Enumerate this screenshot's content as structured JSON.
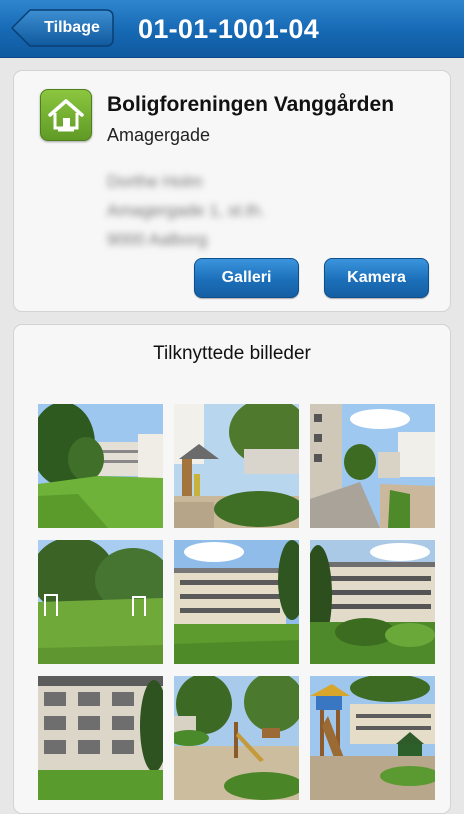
{
  "nav": {
    "back_label": "Tilbage",
    "title": "01-01-1001-04"
  },
  "property": {
    "icon": "home-icon",
    "name": "Boligforeningen Vanggården",
    "street": "Amagergade",
    "blurred_lines": [
      "Dorthe Holm",
      "Amagergade 1, st.th.",
      "9000 Aalborg"
    ]
  },
  "actions": {
    "gallery_label": "Galleri",
    "camera_label": "Kamera"
  },
  "gallery": {
    "title": "Tilknyttede billeder",
    "photos": [
      {
        "subject": "lawn with trees and buildings"
      },
      {
        "subject": "playground with houses"
      },
      {
        "subject": "paved path between buildings"
      },
      {
        "subject": "football field with trees"
      },
      {
        "subject": "apartment block with lawn"
      },
      {
        "subject": "apartment block with garden"
      },
      {
        "subject": "apartment block facade with balconies"
      },
      {
        "subject": "playground with slide"
      },
      {
        "subject": "playhouse on playground"
      }
    ]
  },
  "colors": {
    "nav_blue": "#1668b3",
    "button_blue": "#1c6fba",
    "icon_green": "#6fae2f"
  }
}
